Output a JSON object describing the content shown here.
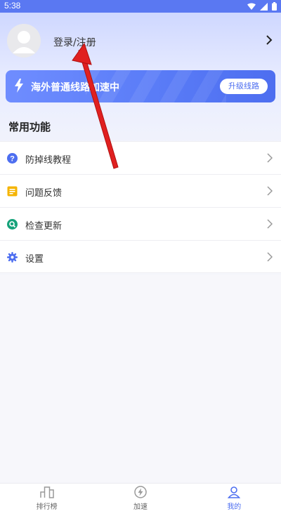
{
  "status_bar": {
    "time": "5:38"
  },
  "profile": {
    "login_label": "登录/注册"
  },
  "banner": {
    "text": "海外普通线路加速中",
    "button_label": "升级线路"
  },
  "section": {
    "title": "常用功能"
  },
  "menu": [
    {
      "label": "防掉线教程",
      "icon": "question-icon",
      "color": "#4d6ef0"
    },
    {
      "label": "问题反馈",
      "icon": "feedback-icon",
      "color": "#f5b400"
    },
    {
      "label": "检查更新",
      "icon": "update-search-icon",
      "color": "#16a27a"
    },
    {
      "label": "设置",
      "icon": "gear-icon",
      "color": "#4d6ef0"
    }
  ],
  "tabs": [
    {
      "label": "排行榜",
      "icon": "ranking-icon",
      "active": false
    },
    {
      "label": "加速",
      "icon": "bolt-icon",
      "active": false
    },
    {
      "label": "我的",
      "icon": "user-icon",
      "active": true
    }
  ],
  "colors": {
    "accent": "#4d6ef0",
    "annotation_arrow": "#e02020"
  }
}
